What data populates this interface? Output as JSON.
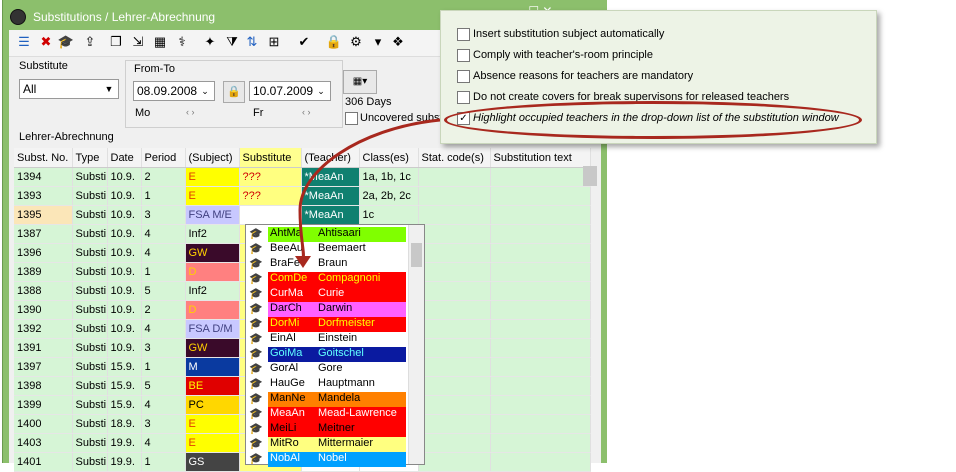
{
  "window": {
    "title": "Substitutions / Lehrer-Abrechnung",
    "controls": "—  ☐  ✕"
  },
  "toolbar_icons": [
    "list-icon",
    "delete-icon",
    "teacher-hat-icon",
    "import-icon",
    "copy-icon",
    "export-icon",
    "calculator-icon",
    "stethoscope-icon",
    "wand-icon",
    "filter-icon",
    "sort-icon",
    "grid-icon",
    "tick-icon",
    "lock-icon",
    "settings-icon",
    "dropdown-icon",
    "extra-icon"
  ],
  "filter": {
    "label": "Substitute",
    "value": "All"
  },
  "fromto": {
    "label": "From-To",
    "from": "08.09.2008",
    "from_day": "Mo",
    "to": "10.07.2009",
    "to_day": "Fr",
    "arrows_left": "‹  ›",
    "arrows_right": "‹  ›"
  },
  "days": {
    "value": "306 Days"
  },
  "uncovered": {
    "label": "Uncovered subst"
  },
  "section_label": "Lehrer-Abrechnung",
  "columns": [
    "Subst. No.",
    "Type",
    "Date",
    "Period",
    "(Subject)",
    "Substitute",
    "(Teacher)",
    "Class(es)",
    "Stat. code(s)",
    "Substitution text"
  ],
  "rows": [
    {
      "no": "1394",
      "type": "Substi",
      "date": "10.9.",
      "period": "2",
      "subject": "E",
      "subj_bg": "#ffff00",
      "subj_fg": "#e04000",
      "sub": "???",
      "teacher": "*MeaAn",
      "classes": "1a, 1b, 1c"
    },
    {
      "no": "1393",
      "type": "Substi",
      "date": "10.9.",
      "period": "1",
      "subject": "E",
      "subj_bg": "#ffff00",
      "subj_fg": "#e04000",
      "sub": "???",
      "teacher": "*MeaAn",
      "classes": "2a, 2b, 2c"
    },
    {
      "no": "1395",
      "type": "Substi",
      "date": "10.9.",
      "period": "3",
      "subject": "FSA M/E",
      "subj_bg": "#c8c8ff",
      "subj_fg": "#404080",
      "sub": "???",
      "teacher": "*MeaAn",
      "classes": "1c"
    },
    {
      "no": "1387",
      "type": "Substi",
      "date": "10.9.",
      "period": "4",
      "subject": "Inf2",
      "subj_bg": "#d6f5d6",
      "subj_fg": "#000000",
      "sub": "",
      "teacher": "",
      "classes": ""
    },
    {
      "no": "1396",
      "type": "Substi",
      "date": "10.9.",
      "period": "4",
      "subject": "GW",
      "subj_bg": "#3a0a2a",
      "subj_fg": "#ffd000",
      "sub": "",
      "teacher": "",
      "classes": ""
    },
    {
      "no": "1389",
      "type": "Substi",
      "date": "10.9.",
      "period": "1",
      "subject": "D",
      "subj_bg": "#ff8080",
      "subj_fg": "#ffd000",
      "sub": "",
      "teacher": "",
      "classes": ""
    },
    {
      "no": "1388",
      "type": "Substi",
      "date": "10.9.",
      "period": "5",
      "subject": "Inf2",
      "subj_bg": "#d6f5d6",
      "subj_fg": "#000000",
      "sub": "",
      "teacher": "",
      "classes": ""
    },
    {
      "no": "1390",
      "type": "Substi",
      "date": "10.9.",
      "period": "2",
      "subject": "D",
      "subj_bg": "#ff8080",
      "subj_fg": "#ffd000",
      "sub": "",
      "teacher": "",
      "classes": ""
    },
    {
      "no": "1392",
      "type": "Substi",
      "date": "10.9.",
      "period": "4",
      "subject": "FSA D/M",
      "subj_bg": "#c8c8ff",
      "subj_fg": "#404080",
      "sub": "",
      "teacher": "",
      "classes": ""
    },
    {
      "no": "1391",
      "type": "Substi",
      "date": "10.9.",
      "period": "3",
      "subject": "GW",
      "subj_bg": "#3a0a2a",
      "subj_fg": "#ffd000",
      "sub": "",
      "teacher": "",
      "classes": ""
    },
    {
      "no": "1397",
      "type": "Substi",
      "date": "15.9.",
      "period": "1",
      "subject": "M",
      "subj_bg": "#0a3aa0",
      "subj_fg": "#ffffff",
      "sub": "",
      "teacher": "",
      "classes": ""
    },
    {
      "no": "1398",
      "type": "Substi",
      "date": "15.9.",
      "period": "5",
      "subject": "BE",
      "subj_bg": "#e00000",
      "subj_fg": "#ffff00",
      "sub": "",
      "teacher": "",
      "classes": ""
    },
    {
      "no": "1399",
      "type": "Substi",
      "date": "15.9.",
      "period": "4",
      "subject": "PC",
      "subj_bg": "#ffd700",
      "subj_fg": "#000000",
      "sub": "",
      "teacher": "",
      "classes": ""
    },
    {
      "no": "1400",
      "type": "Substi",
      "date": "18.9.",
      "period": "3",
      "subject": "E",
      "subj_bg": "#ffff00",
      "subj_fg": "#e04000",
      "sub": "",
      "teacher": "",
      "classes": ""
    },
    {
      "no": "1403",
      "type": "Substi",
      "date": "19.9.",
      "period": "4",
      "subject": "E",
      "subj_bg": "#ffff00",
      "subj_fg": "#e04000",
      "sub": "",
      "teacher": "",
      "classes": ""
    },
    {
      "no": "1401",
      "type": "Substi",
      "date": "19.9.",
      "period": "1",
      "subject": "GS",
      "subj_bg": "#444444",
      "subj_fg": "#ffffff",
      "sub": "",
      "teacher": "",
      "classes": ""
    }
  ],
  "dropdown_items": [
    {
      "short": "AhtMa",
      "full": "Ahtisaari",
      "bg": "#80ff00",
      "fg": "#000000"
    },
    {
      "short": "BeeAu",
      "full": "Beemaert",
      "bg": "#ffffff",
      "fg": "#000000"
    },
    {
      "short": "BraFe",
      "full": "Braun",
      "bg": "#ffffff",
      "fg": "#000000"
    },
    {
      "short": "ComDe",
      "full": "Compagnoni",
      "bg": "#ff0000",
      "fg": "#ffff00"
    },
    {
      "short": "CurMa",
      "full": "Curie",
      "bg": "#ff0000",
      "fg": "#ffffff"
    },
    {
      "short": "DarCh",
      "full": "Darwin",
      "bg": "#ff60ff",
      "fg": "#000000"
    },
    {
      "short": "DorMi",
      "full": "Dorfmeister",
      "bg": "#ff0000",
      "fg": "#ffff00"
    },
    {
      "short": "EinAl",
      "full": "Einstein",
      "bg": "#ffffff",
      "fg": "#000000"
    },
    {
      "short": "GoiMa",
      "full": "Goitschel",
      "bg": "#0a1aa0",
      "fg": "#60ffff"
    },
    {
      "short": "GorAl",
      "full": "Gore",
      "bg": "#ffffff",
      "fg": "#000000"
    },
    {
      "short": "HauGe",
      "full": "Hauptmann",
      "bg": "#ffffff",
      "fg": "#000000"
    },
    {
      "short": "ManNe",
      "full": "Mandela",
      "bg": "#ff8000",
      "fg": "#000000"
    },
    {
      "short": "MeaAn",
      "full": "Mead-Lawrence",
      "bg": "#ff0000",
      "fg": "#ffffff"
    },
    {
      "short": "MeiLi",
      "full": "Meitner",
      "bg": "#ff0000",
      "fg": "#000000"
    },
    {
      "short": "MitRo",
      "full": "Mittermaier",
      "bg": "#ffff80",
      "fg": "#000000"
    },
    {
      "short": "NobAl",
      "full": "Nobel",
      "bg": "#00a0ff",
      "fg": "#ffffff"
    }
  ],
  "options": [
    {
      "label": "Insert substitution subject automatically",
      "checked": false
    },
    {
      "label": "Comply with teacher's-room principle",
      "checked": false
    },
    {
      "label": "Absence reasons for teachers are mandatory",
      "checked": false
    },
    {
      "label": "Do not create covers for break supervisons for released teachers",
      "checked": false
    },
    {
      "label": "Highlight occupied teachers in the drop-down list of the substitution window",
      "checked": true
    }
  ],
  "colors": {
    "window_frame": "#8cbf6c",
    "row_bg": "#d6f5d6",
    "teacher_bg": "#108070",
    "highlight": "#a8281e"
  }
}
